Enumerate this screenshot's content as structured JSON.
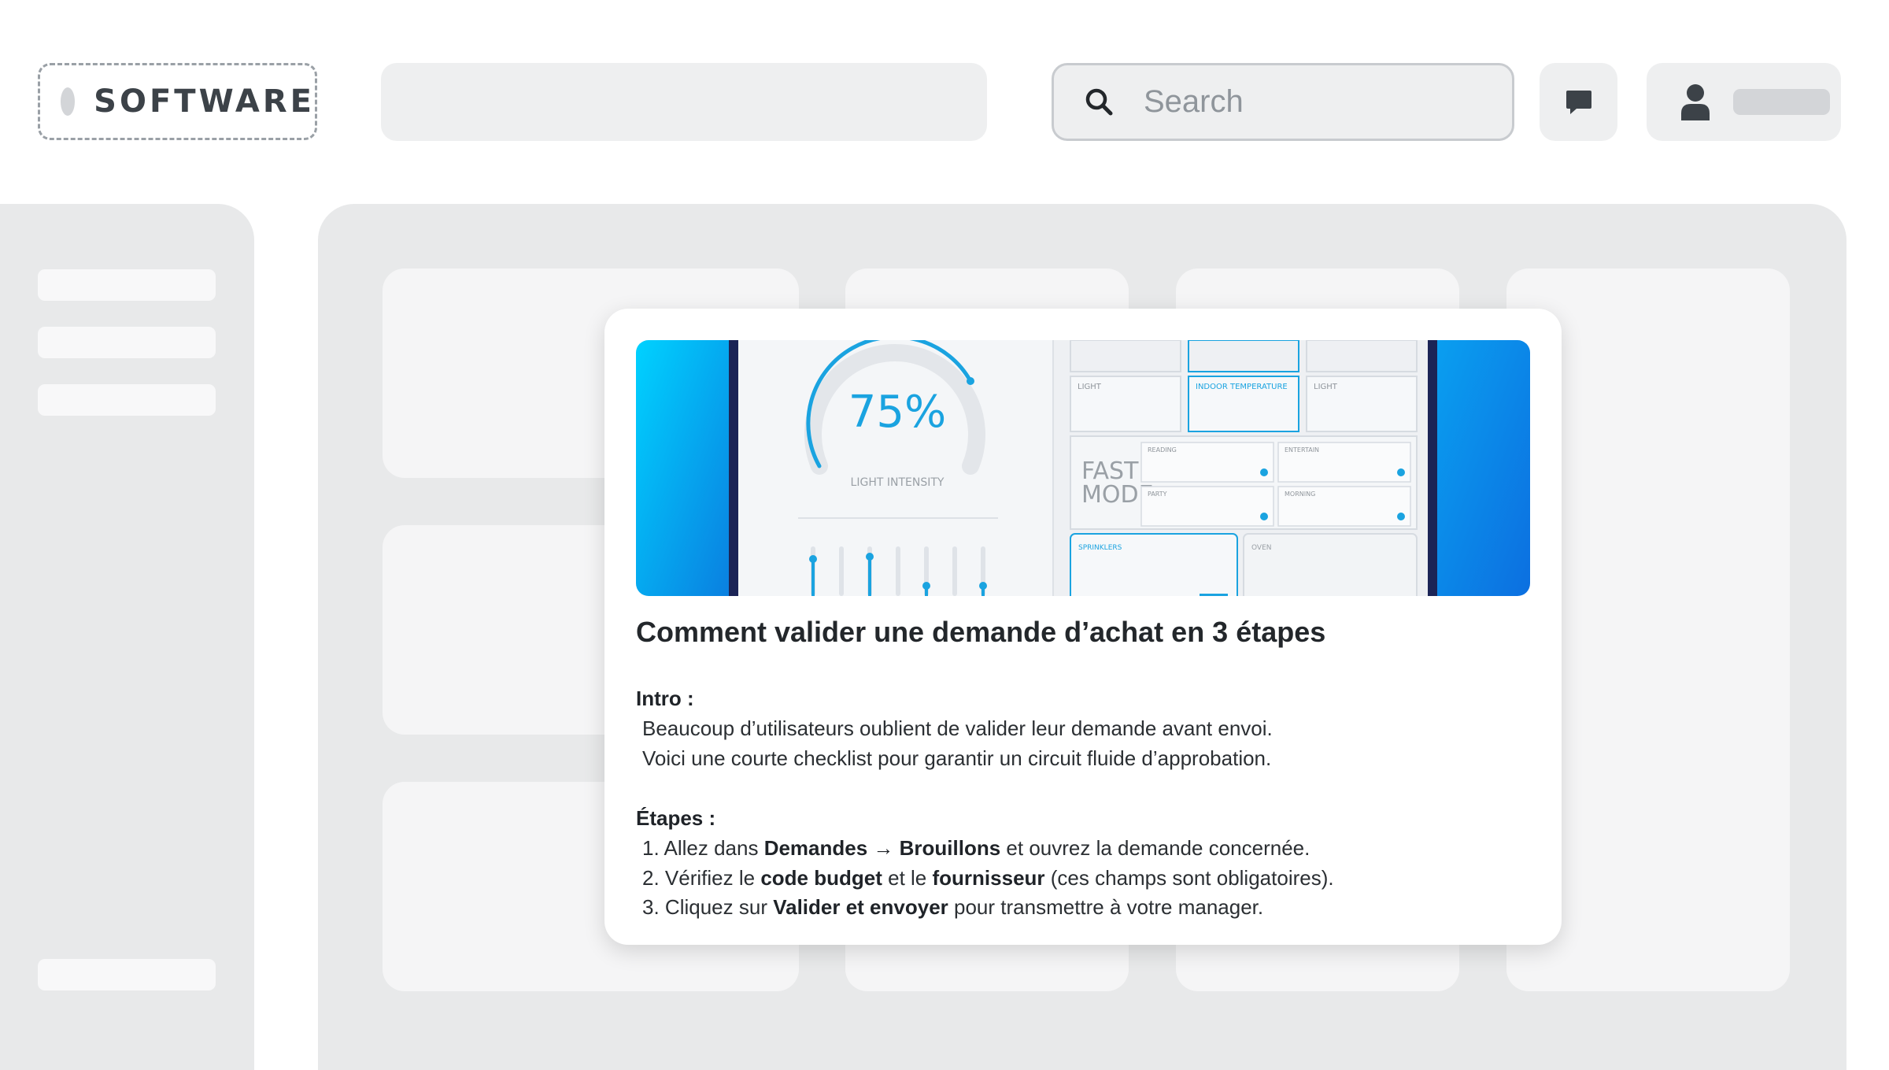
{
  "header": {
    "logo_text": "SOFTWARE",
    "search_placeholder": "Search"
  },
  "hero": {
    "gauge_value": "75%",
    "gauge_label": "LIGHT INTENSITY",
    "tiles": {
      "light_1": "LIGHT",
      "indoor_temperature": "INDOOR TEMPERATURE",
      "light_2": "LIGHT",
      "fast_mode_line1": "FAST",
      "fast_mode_line2": "MODE",
      "reading": "READING",
      "entertain": "ENTERTAIN",
      "party": "PARTY",
      "morning": "MORNING",
      "sprinklers": "SPRINKLERS",
      "oven": "OVEN"
    },
    "accent_color": "#1aa3e0"
  },
  "article": {
    "title": "Comment valider une demande d’achat en 3 étapes",
    "intro_label": "Intro :",
    "intro_lines": [
      "Beaucoup d’utilisateurs oublient de valider leur demande avant envoi.",
      "Voici une courte checklist pour garantir un circuit fluide d’approbation."
    ],
    "steps_label": "Étapes :",
    "steps": [
      {
        "num": "1.",
        "p1": "Allez dans",
        "b1": "Demandes → Brouillons",
        "p2": "et ouvrez la demande concernée."
      },
      {
        "num": "2.",
        "p1": "Vérifiez le",
        "b1": "code budget",
        "p2": "et le",
        "b2": "fournisseur",
        "p3": "(ces champs sont obligatoires)."
      },
      {
        "num": "3.",
        "p1": "Cliquez sur",
        "b1": "Valider et envoyer",
        "p2": "pour transmettre à votre manager."
      }
    ]
  },
  "icons": {
    "search": "search-icon",
    "chat": "chat-icon",
    "user": "user-icon"
  }
}
